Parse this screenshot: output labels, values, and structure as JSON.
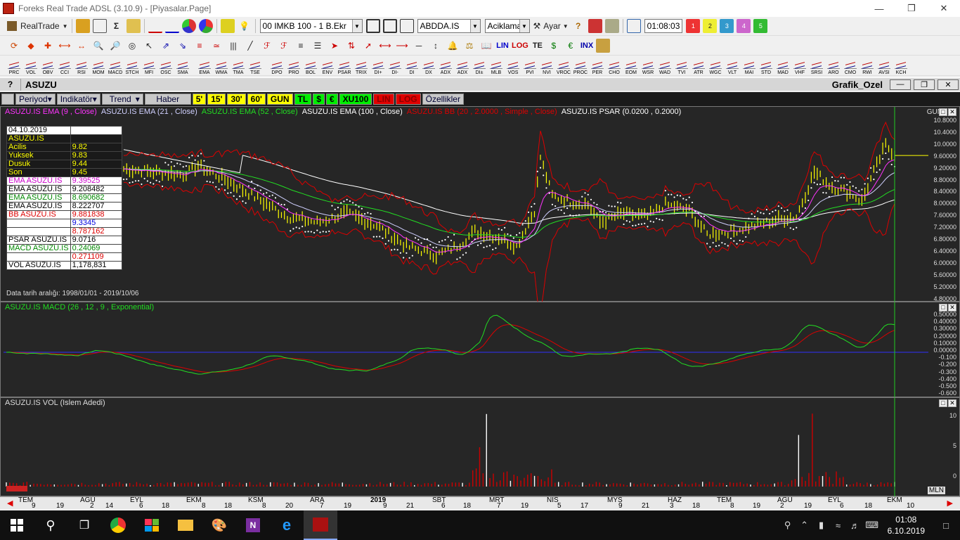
{
  "window": {
    "title": "Foreks Real Trade ADSL (3.10.9) - [Piyasalar.Page]"
  },
  "toolbar1": {
    "realtrade_label": "RealTrade",
    "index_select": "00 IMKB 100 - 1 B.Ekr",
    "symbol_select": "ABDDA.IS",
    "aciklama_select": "Aciklama",
    "ayar_label": "Ayar",
    "clock": "01:08:03"
  },
  "toolbar2": {
    "labels": [
      "LIN",
      "LOG",
      "TE",
      "INX"
    ]
  },
  "indicators": [
    "PRC",
    "VOL",
    "OBV",
    "CCI",
    "RSI",
    "MOM",
    "MACD",
    "STCH",
    "MFI",
    "OSC",
    "SMA",
    "EMA",
    "WMA",
    "TMA",
    "TSE",
    "DPO",
    "PRO",
    "BOL",
    "ENV",
    "PSAR",
    "TRIX",
    "DI+",
    "DI-",
    "DI",
    "DX",
    "ADX",
    "ADX",
    "DI±",
    "MLB",
    "VOS",
    "PVI",
    "NVI",
    "VROC",
    "PROC",
    "PER",
    "CHO",
    "EOM",
    "WSR",
    "WAD",
    "TVI",
    "ATR",
    "WGC",
    "VLT",
    "MAI",
    "STD",
    "MAD",
    "VHF",
    "SRSI",
    "ARO",
    "CMO",
    "RWI",
    "AVSI",
    "KCH"
  ],
  "symbolbar": {
    "help": "?",
    "symbol": "ASUZU",
    "window_name": "Grafik_Ozel"
  },
  "chartbar": {
    "periyod": "Periyod",
    "indikator": "Indikatör",
    "trend": "Trend",
    "haber": "Haber",
    "periods": [
      "5'",
      "15'",
      "30'",
      "60'",
      "GUN"
    ],
    "units": [
      "TL",
      "$",
      "€",
      "XU100"
    ],
    "scales": [
      "LIN",
      "LOG"
    ],
    "ozellikler": "Özellikler"
  },
  "price_pane": {
    "legend": [
      {
        "text": "ASUZU.IS EMA (9 , Close)",
        "color": "#ff33ff"
      },
      {
        "text": "ASUZU.IS EMA (21 , Close)",
        "color": "#d0d0ff"
      },
      {
        "text": "ASUZU.IS EMA (52 , Close)",
        "color": "#22dd22"
      },
      {
        "text": "ASUZU.IS EMA (100 , Close)",
        "color": "#ffffff"
      },
      {
        "text": "ASUZU.IS BB (20 , 2.0000 , Simple , Close)",
        "color": "#dd0000"
      },
      {
        "text": "ASUZU.IS PSAR (0.0200 , 0.2000)",
        "color": "#ffffff"
      }
    ],
    "period_label": "GUN",
    "data_range": "Data tarih aralığı: 1998/01/01 - 2019/10/06",
    "yticks": [
      "10.8000",
      "10.4000",
      "10.0000",
      "9.60000",
      "9.20000",
      "8.80000",
      "8.40000",
      "8.00000",
      "7.60000",
      "7.20000",
      "6.80000",
      "6.40000",
      "6.00000",
      "5.60000",
      "5.20000",
      "4.80000"
    ]
  },
  "info_table": [
    {
      "k": "04.10.2019",
      "v": "",
      "kc": "#000",
      "vc": "#000"
    },
    {
      "k": "ASUZU.IS",
      "v": "",
      "kc": "#000",
      "vc": "#000"
    },
    {
      "k": " Acilis",
      "v": "9.82",
      "kc": "#000",
      "vc": "#000"
    },
    {
      "k": " Yuksek",
      "v": "9.83",
      "kc": "#000",
      "vc": "#000"
    },
    {
      "k": " Dusuk",
      "v": "9.44",
      "kc": "#000",
      "vc": "#000"
    },
    {
      "k": " Son",
      "v": "9.45",
      "kc": "#000",
      "vc": "#000"
    },
    {
      "k": "EMA ASUZU.IS",
      "v": "9.39525",
      "kc": "#cc00cc",
      "vc": "#cc00cc"
    },
    {
      "k": "EMA ASUZU.IS",
      "v": "9.208482",
      "kc": "#000",
      "vc": "#000"
    },
    {
      "k": "EMA ASUZU.IS",
      "v": "8.690682",
      "kc": "#008800",
      "vc": "#008800"
    },
    {
      "k": "EMA ASUZU.IS",
      "v": "8.222707",
      "kc": "#000",
      "vc": "#000"
    },
    {
      "k": "BB ASUZU.IS",
      "v": "9.881838",
      "kc": "#dd0000",
      "vc": "#dd0000"
    },
    {
      "k": "",
      "v": "9.3345",
      "kc": "#000",
      "vc": "#0000dd"
    },
    {
      "k": "",
      "v": "8.787162",
      "kc": "#000",
      "vc": "#dd0000"
    },
    {
      "k": "PSAR ASUZU.IS",
      "v": "9.0716",
      "kc": "#000",
      "vc": "#000"
    },
    {
      "k": "MACD ASUZU.IS",
      "v": "0.24069",
      "kc": "#008800",
      "vc": "#008800"
    },
    {
      "k": "",
      "v": "0.271109",
      "kc": "#000",
      "vc": "#dd0000"
    },
    {
      "k": "VOL ASUZU.IS",
      "v": "1,178,831",
      "kc": "#000",
      "vc": "#000"
    }
  ],
  "macd_pane": {
    "title": "ASUZU.IS MACD (26 , 12 , 9 , Exponential)",
    "yticks": [
      "0.50000",
      "0.40000",
      "0.30000",
      "0.20000",
      "0.10000",
      "0.00000",
      "-0.100",
      "-0.200",
      "-0.300",
      "-0.400",
      "-0.500",
      "-0.600"
    ]
  },
  "vol_pane": {
    "title": "ASUZU.IS VOL (Islem Adedi)",
    "yticks": [
      "10",
      "5",
      "0"
    ],
    "unit": "MLN"
  },
  "date_axis": {
    "months": [
      "TEM",
      "AGU",
      "EYL",
      "EKM",
      "KSM",
      "ARA",
      "2019",
      "SBT",
      "MRT",
      "NIS",
      "MYS",
      "HAZ",
      "TEM",
      "AGU",
      "EYL",
      "EKM"
    ],
    "days": [
      "9",
      "19",
      "2",
      "14",
      "6",
      "18",
      "8",
      "18",
      "8",
      "20",
      "7",
      "19",
      "9",
      "21",
      "6",
      "18",
      "7",
      "19",
      "5",
      "17",
      "9",
      "21",
      "3",
      "18",
      "8",
      "19",
      "2",
      "19",
      "6",
      "18",
      "10"
    ]
  },
  "taskbar": {
    "time": "01:08",
    "date": "6.10.2019"
  },
  "colors": {
    "bg": "#262626",
    "price": "#ffff00",
    "ema9": "#ff33ff",
    "ema21": "#d0d0ff",
    "ema52": "#22dd22",
    "ema100": "#ffffff",
    "bb": "#dd0000",
    "macd": "#22dd22",
    "signal": "#dd0000",
    "vol": "#cc0000"
  }
}
